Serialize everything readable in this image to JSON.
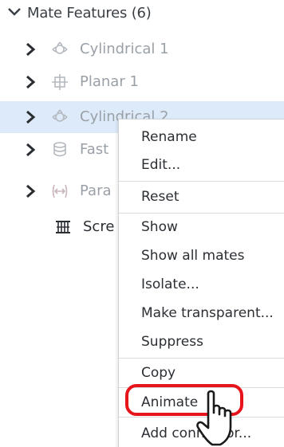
{
  "tree": {
    "section_title": "Mate Features (6)",
    "items": [
      {
        "label": "Cylindrical 1",
        "icon": "cylindrical-mate-icon"
      },
      {
        "label": "Planar 1",
        "icon": "planar-mate-icon"
      },
      {
        "label": "Cylindrical 2",
        "icon": "cylindrical-mate-icon"
      },
      {
        "label": "Fast",
        "icon": "fastened-mate-icon"
      },
      {
        "label": "Para",
        "icon": "parallel-mate-icon"
      },
      {
        "label": "Scre",
        "icon": "screw-relation-icon"
      }
    ]
  },
  "context_menu": {
    "items": [
      "Rename",
      "Edit...",
      "Reset",
      "Show",
      "Show all mates",
      "Isolate...",
      "Make transparent...",
      "Suppress",
      "Copy",
      "Animate",
      "Add connector..."
    ]
  },
  "colors": {
    "selection_bg": "#ddeaf9",
    "highlight_ring": "#e8141c",
    "muted_text": "#9aa0a7",
    "text": "#2b2f34"
  }
}
